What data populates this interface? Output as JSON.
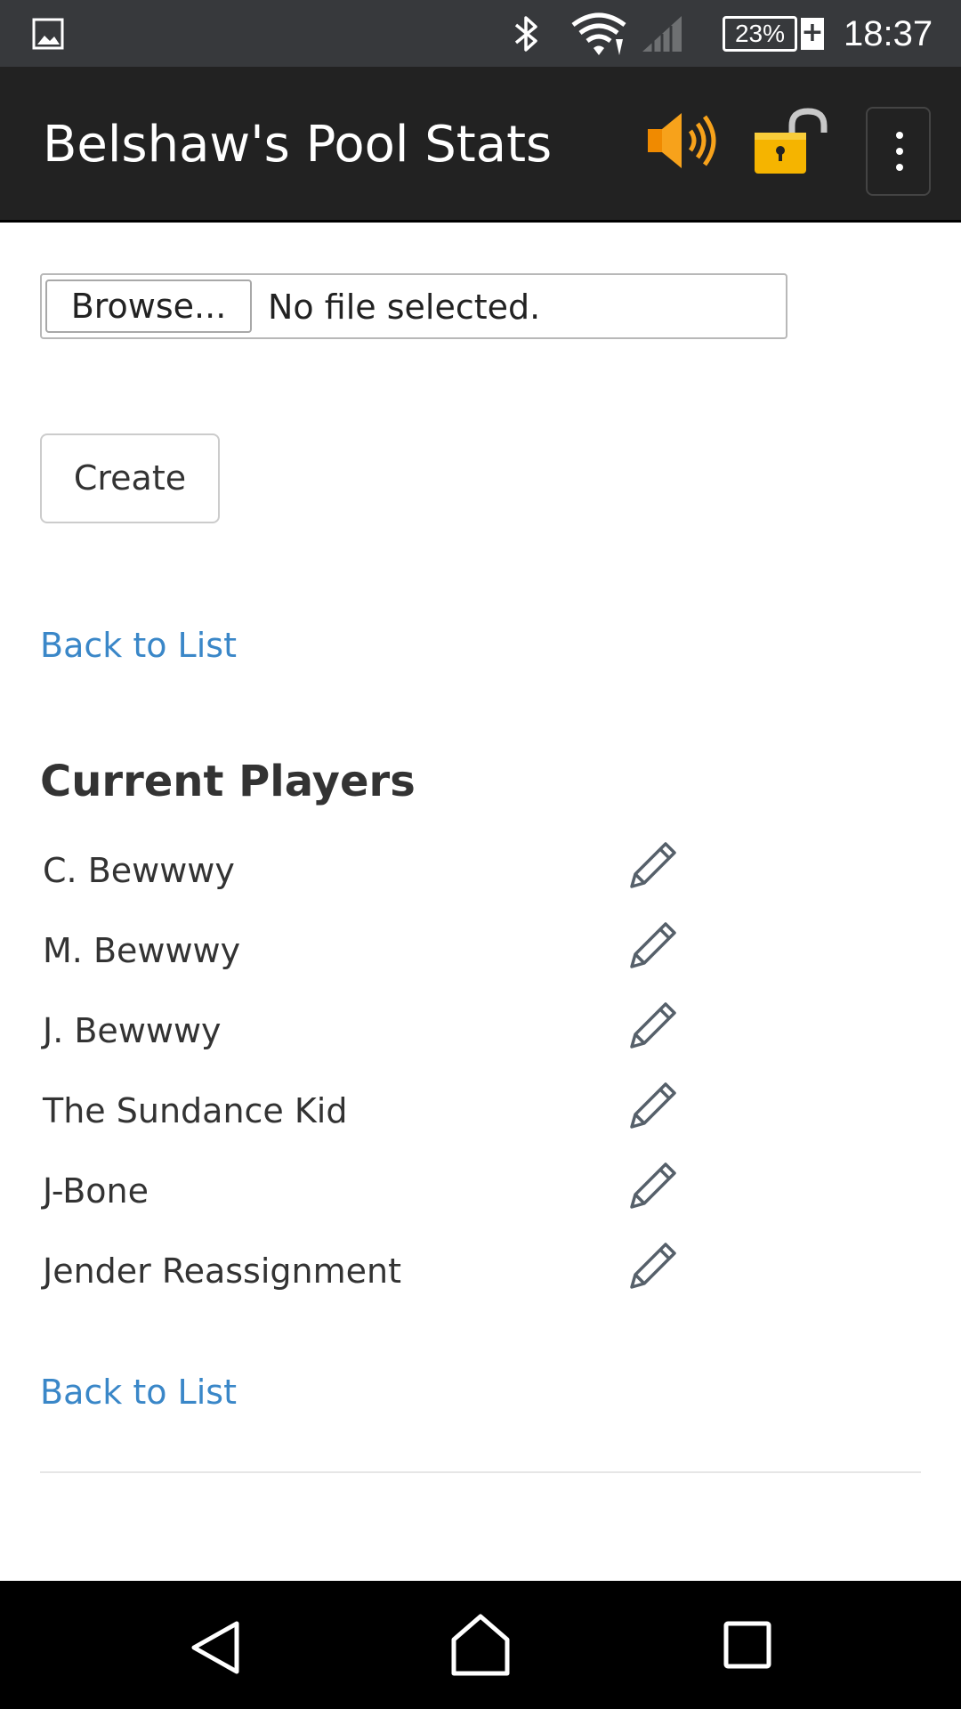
{
  "status_bar": {
    "battery_percent": "23%",
    "battery_plug": "+",
    "time": "18:37",
    "icons": [
      "gallery-icon",
      "bluetooth-icon",
      "wifi-icon",
      "signal-icon",
      "battery-icon"
    ]
  },
  "app_bar": {
    "title": "Belshaw's Pool Stats",
    "icons": [
      "speaker-icon",
      "unlocked-padlock-icon",
      "more-vert-icon"
    ],
    "accent": "#222222"
  },
  "form": {
    "browse_label": "Browse...",
    "file_status": "No file selected.",
    "create_label": "Create"
  },
  "links": {
    "back_to_list_1": "Back to List",
    "back_to_list_2": "Back to List",
    "color": "#3a87c8"
  },
  "players": {
    "heading": "Current Players",
    "items": [
      {
        "name": "C. Bewwwy"
      },
      {
        "name": "M. Bewwwy"
      },
      {
        "name": "J. Bewwwy"
      },
      {
        "name": "The Sundance Kid"
      },
      {
        "name": "J-Bone"
      },
      {
        "name": "Jender Reassignment"
      }
    ]
  },
  "nav_bar": {
    "icons": [
      "back-icon",
      "home-icon",
      "recent-apps-icon"
    ]
  }
}
